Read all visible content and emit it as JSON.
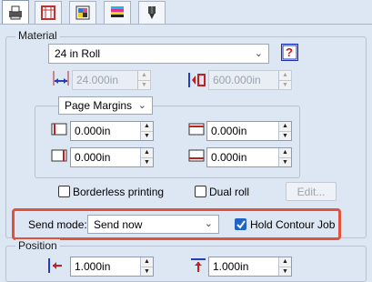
{
  "tabs": [
    {
      "icon": "printer-settings-icon"
    },
    {
      "icon": "page-layout-icon"
    },
    {
      "icon": "color-image-icon"
    },
    {
      "icon": "color-bars-icon"
    },
    {
      "icon": "cutter-tool-icon"
    }
  ],
  "material": {
    "title": "Material",
    "media": "24 in Roll",
    "width": "24.000in",
    "length": "600.000in"
  },
  "margins": {
    "mode": "Page Margins",
    "left": "0.000in",
    "top": "0.000in",
    "right": "0.000in",
    "bottom": "0.000in"
  },
  "options": {
    "borderless_label": "Borderless printing",
    "borderless_checked": false,
    "dual_roll_label": "Dual roll",
    "dual_roll_checked": false,
    "edit_label": "Edit..."
  },
  "send": {
    "label": "Send mode:",
    "value": "Send now",
    "hold_contour_label": "Hold Contour Job",
    "hold_contour_checked": true
  },
  "position": {
    "title": "Position",
    "x": "1.000in",
    "y": "1.000in"
  },
  "colors": {
    "highlight": "#e0533a",
    "checkbox_checked": "#1f63c6",
    "background": "#dde7f3"
  }
}
